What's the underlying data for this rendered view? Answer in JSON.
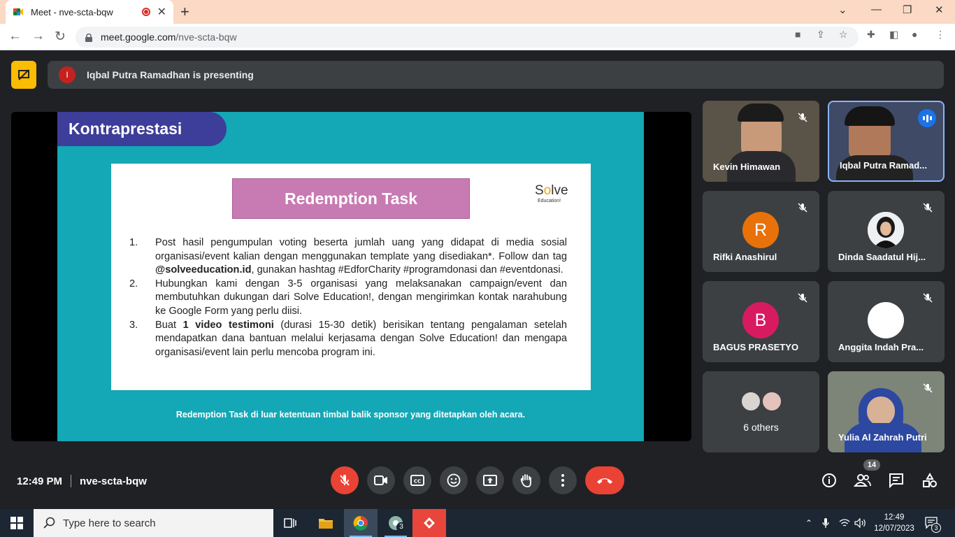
{
  "browser": {
    "tab_title": "Meet - nve-scta-bqw",
    "url_host": "meet.google.com",
    "url_path": "/nve-scta-bqw"
  },
  "meet": {
    "presenting_initial": "I",
    "presenting_text": "Iqbal Putra Ramadhan is presenting",
    "meeting_code": "nve-scta-bqw",
    "time": "12:49 PM",
    "participants_badge": "14"
  },
  "slide": {
    "title": "Kontraprestasi",
    "card_heading": "Redemption Task",
    "logo_main": "Solve",
    "logo_sub": "Education!",
    "tasks": [
      {
        "num": "1.",
        "text_a": "Post hasil pengumpulan voting beserta jumlah uang yang didapat di media sosial organisasi/event kalian dengan menggunakan template yang disediakan*. Follow dan tag ",
        "bold": "@solveeducation.id",
        "text_b": ", gunakan hashtag #EdforCharity #programdonasi dan #eventdonasi."
      },
      {
        "num": "2.",
        "text_a": "Hubungkan kami dengan 3-5 organisasi yang melaksanakan campaign/event dan membutuhkan dukungan dari Solve Education!, dengan mengirimkan kontak narahubung ke Google Form yang perlu diisi.",
        "bold": "",
        "text_b": ""
      },
      {
        "num": "3.",
        "text_a": "Buat ",
        "bold": "1 video testimoni",
        "text_b": " (durasi 15-30 detik) berisikan tentang pengalaman setelah mendapatkan dana bantuan melalui kerjasama dengan Solve Education! dan mengapa organisasi/event lain perlu mencoba program ini."
      }
    ],
    "footer": "Redemption Task di luar ketentuan timbal balik sponsor yang ditetapkan oleh acara."
  },
  "participants": [
    {
      "name": "Kevin Himawan",
      "type": "video"
    },
    {
      "name": "Iqbal Putra Ramad...",
      "type": "video"
    },
    {
      "name": "Rifki Anashirul",
      "type": "avatar",
      "initial": "R",
      "color": "#e8710a"
    },
    {
      "name": "Dinda Saadatul Hij...",
      "type": "photo"
    },
    {
      "name": "BAGUS PRASETYO",
      "type": "avatar",
      "initial": "B",
      "color": "#d81b60"
    },
    {
      "name": "Anggita Indah Pra...",
      "type": "avatar",
      "initial": "",
      "color": "#ffffff"
    },
    {
      "name": "6 others",
      "type": "others"
    },
    {
      "name": "Yulia Al Zahrah Putri",
      "type": "video"
    }
  ],
  "taskbar": {
    "search_placeholder": "Type here to search",
    "clock_time": "12:49",
    "clock_date": "12/07/2023",
    "notification_count": "3",
    "app_badge": "3"
  }
}
